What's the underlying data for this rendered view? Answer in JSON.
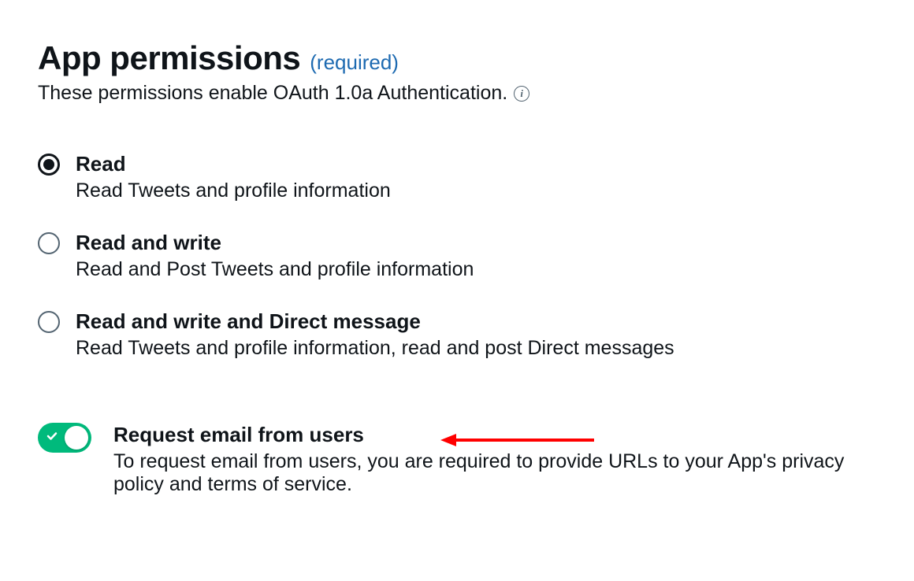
{
  "header": {
    "title": "App permissions",
    "required_label": "(required)",
    "subtitle": "These permissions enable OAuth 1.0a Authentication."
  },
  "permissions": [
    {
      "label": "Read",
      "description": "Read Tweets and profile information",
      "selected": true
    },
    {
      "label": "Read and write",
      "description": "Read and Post Tweets and profile information",
      "selected": false
    },
    {
      "label": "Read and write and Direct message",
      "description": "Read Tweets and profile information, read and post Direct messages",
      "selected": false
    }
  ],
  "email_toggle": {
    "label": "Request email from users",
    "description": "To request email from users, you are required to provide URLs to your App's privacy policy and terms of service.",
    "enabled": true
  },
  "colors": {
    "accent_link": "#1d6ab1",
    "toggle_on": "#00ba7c",
    "annotation_red": "#ff0000"
  }
}
